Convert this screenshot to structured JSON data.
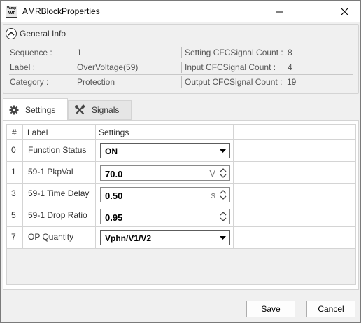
{
  "window": {
    "title": "AMRBlockProperties",
    "icon_text": [
      "Vamp",
      "AMR"
    ],
    "controls": [
      "minimize-icon",
      "maximize-icon",
      "close-icon"
    ]
  },
  "general_info": {
    "header": "General Info",
    "rows": [
      {
        "label": "Sequence :",
        "value": "1",
        "label2": "Setting CFCSignal Count :",
        "value2": "8"
      },
      {
        "label": "Label :",
        "value": "OverVoltage(59)",
        "label2": "Input CFCSignal Count :",
        "value2": "4"
      },
      {
        "label": "Category :",
        "value": "Protection",
        "label2": "Output CFCSignal Count :",
        "value2": "19"
      }
    ]
  },
  "tabs": [
    {
      "label": "Settings",
      "icon": "gear-icon",
      "selected": true
    },
    {
      "label": "Signals",
      "icon": "tools-icon",
      "selected": false
    }
  ],
  "grid": {
    "headers": {
      "num": "#",
      "label": "Label",
      "settings": "Settings"
    },
    "rows": [
      {
        "num": "0",
        "label": "Function Status",
        "kind": "combo",
        "value": "ON",
        "unit": ""
      },
      {
        "num": "1",
        "label": "59-1 PkpVal",
        "kind": "spin",
        "value": "70.0",
        "unit": "V"
      },
      {
        "num": "3",
        "label": "59-1 Time Delay",
        "kind": "spin",
        "value": "0.50",
        "unit": "s"
      },
      {
        "num": "5",
        "label": "59-1 Drop Ratio",
        "kind": "spin",
        "value": "0.95",
        "unit": ""
      },
      {
        "num": "7",
        "label": "OP Quantity",
        "kind": "combo",
        "value": "Vphn/V1/V2",
        "unit": ""
      }
    ]
  },
  "footer": {
    "save_label": "Save",
    "cancel_label": "Cancel"
  }
}
